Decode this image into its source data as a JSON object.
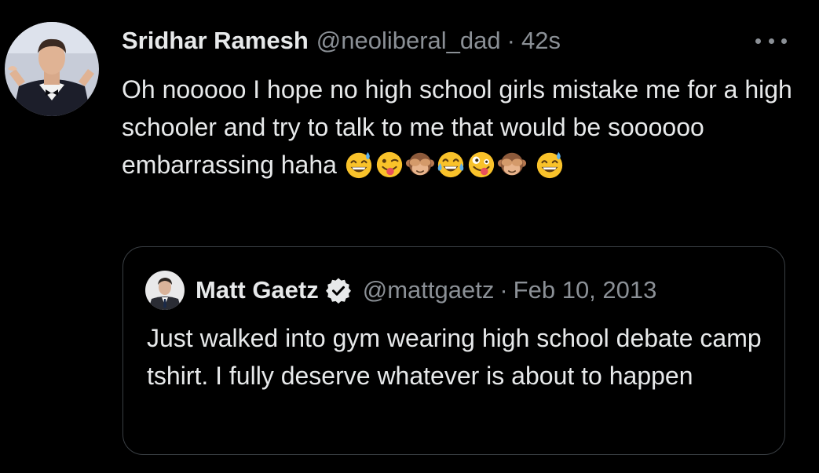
{
  "tweet": {
    "display_name": "Sridhar Ramesh",
    "handle": "@neoliberal_dad",
    "separator": "·",
    "time": "42s",
    "text": "Oh nooooo I hope no high school girls mistake me for a high schooler and try to talk to me that would be soooooo embarrassing haha",
    "emojis": [
      "grinning-sweat-emoji",
      "winking-tongue-emoji",
      "see-no-evil-monkey-emoji",
      "tears-of-joy-emoji",
      "zany-face-emoji",
      "see-no-evil-monkey-emoji",
      "grinning-sweat-emoji"
    ],
    "more_icon": "more-horizontal-icon"
  },
  "quoted_tweet": {
    "display_name": "Matt Gaetz",
    "verified_icon": "verified-badge-icon",
    "handle": "@mattgaetz",
    "separator": "·",
    "date": "Feb 10, 2013",
    "text": "Just walked into gym wearing high school debate camp tshirt. I fully deserve whatever is about to happen"
  },
  "colors": {
    "background": "#000000",
    "primary_text": "#e7e9ea",
    "secondary_text": "#8b9096",
    "border": "#3a3f44"
  }
}
